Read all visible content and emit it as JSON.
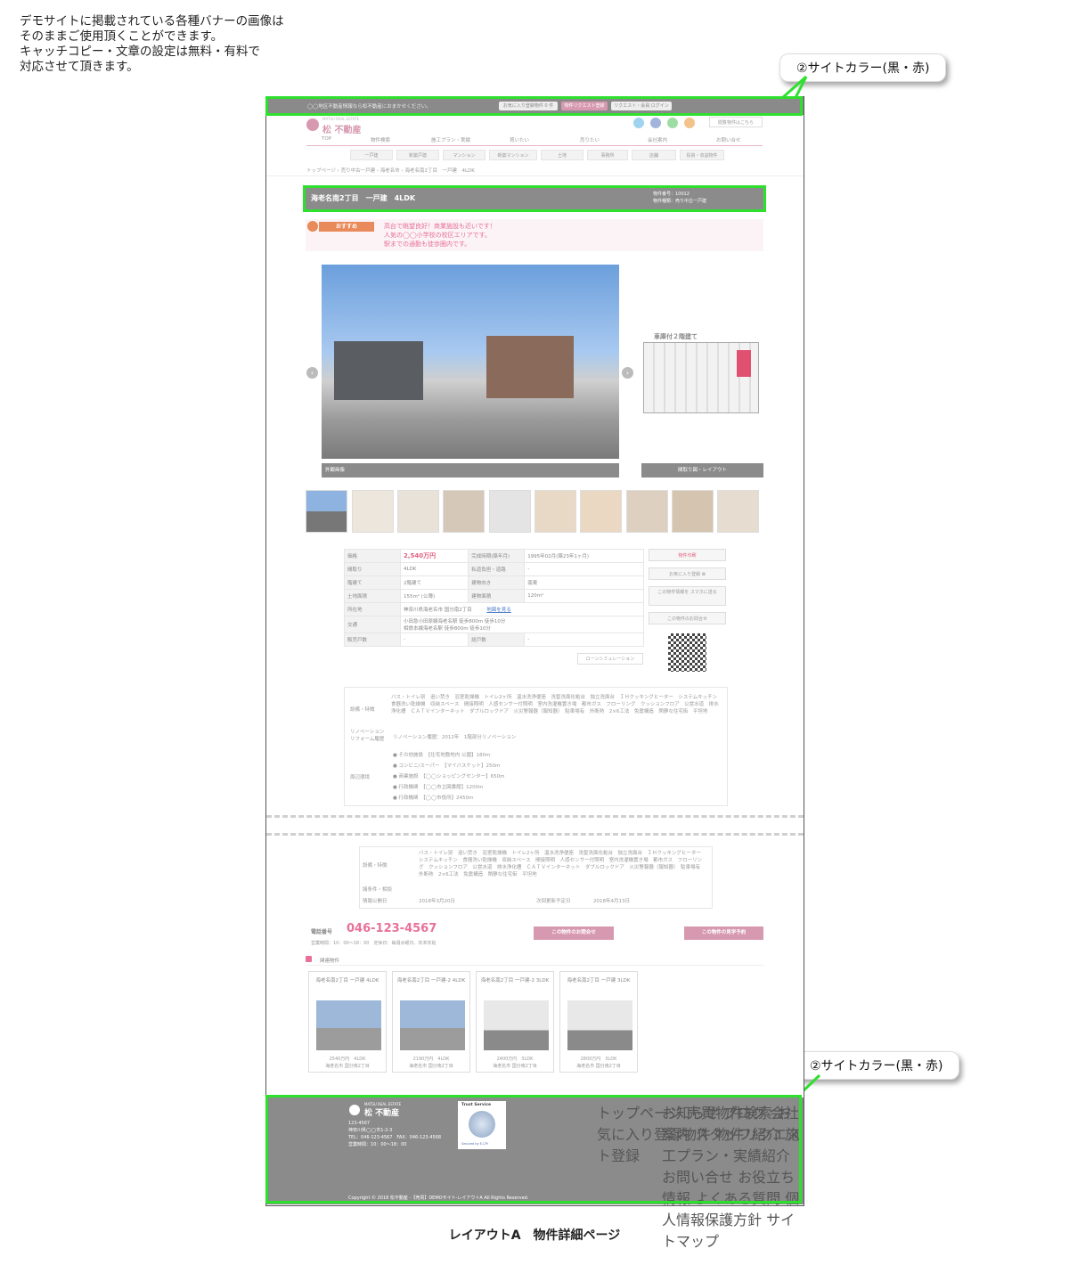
{
  "note": "デモサイトに掲載されている各種バナーの画像は\nそのままご使用頂くことができます。\nキャッチコピー・文章の設定は無料・有料で\n対応させて頂きます。",
  "callouts": {
    "top": "②サイトカラー(黒・赤)",
    "bottom": "②サイトカラー(黒・赤)"
  },
  "caption": "レイアウトA　物件詳細ページ",
  "topbar": {
    "text": "◯◯地区不動産情報なら松不動産におまかせください。",
    "fav": "お気に入り登録物件 0 件",
    "request": "物件リクエスト登録",
    "guest": "リクエスト・会員 ログイン"
  },
  "header": {
    "logo_sub": "MATSU REAL ESTATE",
    "logo": "松 不動産",
    "past_btn": "閲覧物件はこちら"
  },
  "nav": [
    "TOP",
    "物件検索",
    "施工プラン・実績",
    "買いたい",
    "売りたい",
    "会社案内",
    "お問い合せ"
  ],
  "subnav": [
    "一戸建",
    "新築戸建",
    "マンション",
    "新築マンション",
    "土地",
    "事務所",
    "店舗",
    "投資・収益物件"
  ],
  "breadcrumb": "トップページ › 売り中古一戸建 › 海老名市 › 海老名南2丁目　一戸建　4LDK",
  "title": {
    "name": "海老名南2丁目　一戸建　4LDK",
    "number": "物件番号：10012",
    "type": "物件種類：売り中古一戸建"
  },
  "recommend": {
    "label": "おすすめ",
    "lines": [
      "高台で眺望良好！商業施設も近いです！",
      "人気の◯◯小学校の校区エリアです。",
      "駅までの通勤も徒歩圏内です。"
    ]
  },
  "gallery": {
    "main_caption": "外観画像",
    "side_caption": "間取り図・レイアウト",
    "floor_title": "車庫付２階建て"
  },
  "spec": {
    "rows": [
      [
        "価格",
        "2,540万円",
        "完成時期(築年月)",
        "1995年02月(築23年1ヶ月)"
      ],
      [
        "間取り",
        "4LDK",
        "私道負担・道路",
        "-"
      ],
      [
        "階建て",
        "2階建て",
        "建物向き",
        "南東"
      ],
      [
        "土地面積",
        "155m² (公簿)",
        "建物面積",
        "120m²"
      ]
    ],
    "address_label": "所在地",
    "address": "神奈川県海老名市 国分南2丁目",
    "map_link": "地図を見る",
    "traffic_label": "交通",
    "traffic": [
      "小田急小田原線海老名駅 徒歩800m 徒歩10分",
      "相鉄本線海老名駅 徒歩800m 徒歩10分"
    ],
    "units_label": "販売戸数",
    "units": "-",
    "total_label": "総戸数",
    "total": "-",
    "loan_btn": "ローンシミュレーション"
  },
  "side": {
    "print": "物件印刷",
    "fav": "お気に入り登録 ✿",
    "mobile": "この物件情報を スマホに送る",
    "contact": "この物件のお問合せ"
  },
  "features": {
    "equip_label": "設備・特徴",
    "equip": "バス・トイレ別　追い焚き　浴室乾燥機　トイレ2ヶ所　温水洗浄便座　洗髪洗面化粧台　独立洗面台　ＩＨクッキングヒーター　システムキッチン　食器洗い乾燥機　収納スペース　間接照明　人感センサー付照明　室内洗濯機置き場　都市ガス　フローリング　クッションフロア　公営水道　排水浄化槽　ＣＡＴＶインターネット　ダブルロックドア　火災警報器（報知器）　駐車場有　外断熱　2×6工法　免震構造　閑静な住宅街　平坦地",
    "reno_label": "リノベーション リフォーム履歴",
    "reno": "リノベーション履歴：2012年　1階部分リノベーション",
    "env_label": "周辺環境",
    "env": [
      "● その他施設　【住宅地敷地内 公園】180m",
      "● コンビニ/スーパー　【マイバスケット】250m",
      "● 商業施設　【◯◯ショッピングセンター】650m",
      "● 行政機関　【◯◯市立図書館】1200m",
      "● 行政機関　【◯◯市役所】2450m"
    ]
  },
  "lower": {
    "equip_label": "設備・特徴",
    "equip": "バス・トイレ別　追い焚き　浴室乾燥機　トイレ2ヶ所　温水洗浄便座　洗髪洗面化粧台　独立洗面台　ＩＨクッキングヒーター　システムキッチン　食器洗い乾燥機　収納スペース　間接照明　人感センサー付照明　室内洗濯機置き場　都市ガス　フローリング　クッションフロア　公営水道　排水浄化槽　ＣＡＴＶインターネット　ダブルロックドア　火災警報器（報知器）　駐車場有　外断熱　2×6工法　免震構造　閑静な住宅街　平坦地",
    "cond_label": "諸条件・相談",
    "pub_label": "情報公開日",
    "pub": "2018年3月20日",
    "next_label": "次回更新予定日",
    "next": "2018年4月13日"
  },
  "contact": {
    "tel_label": "電話番号",
    "tel": "046-123-4567",
    "hours": "営業時間：10：00〜18：00　定休日：毎週水曜日、年末年始",
    "inquiry_btn": "この物件のお問合せ",
    "visit_btn": "この物件の見学予約"
  },
  "related": {
    "heading": "関連物件",
    "items": [
      {
        "title": "海老名南2丁目 一戸建 4LDK",
        "price": "2540万円　4LDK",
        "addr": "海老名市 国分南2丁目"
      },
      {
        "title": "海老名南2丁目 一戸建-2 4LDK",
        "price": "2190万円　4LDK",
        "addr": "海老名市 国分南2丁目"
      },
      {
        "title": "海老名南2丁目 一戸建-2 3LDK",
        "price": "2400万円　3LDK",
        "addr": "海老名市 国分南2丁目"
      },
      {
        "title": "海老名南2丁目 一戸建 3LDK",
        "price": "2800万円　3LDK",
        "addr": "海老名市 国分南2丁目"
      }
    ]
  },
  "footer": {
    "logo_sub": "MATSU REAL ESTATE",
    "logo": "松 不動産",
    "address": [
      "123-4567",
      "神奈川県◯◯市1-2-3",
      "TEL：046-123-4567　FAX：046-123-4568",
      "営業時間：10：00〜18：00"
    ],
    "trust_label": "Trust Service",
    "trust_sub": "Secured by E-CPI",
    "links1": [
      "トップページ",
      "売買物件検索",
      "お気に入り登録物件",
      "物件リクエスト登録"
    ],
    "links2": [
      "お知らせ",
      "ブログ",
      "会社案内",
      "スタッフ紹介",
      "施工プラン・実績紹介",
      "お問い合せ",
      "お役立ち情報",
      "よくある質問",
      "個人情報保護方針",
      "サイトマップ"
    ],
    "copyright": "Copyright © 2018 松不動産 -【売買】DEMOサイト-レイアウトA All Rights Reserved."
  },
  "colors": {
    "accent": "#d799b0",
    "price": "#e06080",
    "frame_gray": "#8b8b8b",
    "highlight": "#2ee02e"
  }
}
